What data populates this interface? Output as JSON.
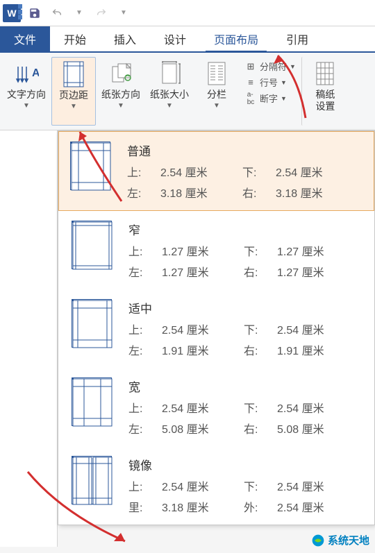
{
  "titlebar": {
    "app_letter": "W"
  },
  "tabs": {
    "file": "文件",
    "home": "开始",
    "insert": "插入",
    "design": "设计",
    "layout": "页面布局",
    "references": "引用"
  },
  "ribbon": {
    "text_direction": "文字方向",
    "margins": "页边距",
    "orientation": "纸张方向",
    "size": "纸张大小",
    "columns": "分栏",
    "breaks": "分隔符",
    "line_numbers": "行号",
    "hyphenation": "断字",
    "manuscript": "稿纸",
    "settings": "设置"
  },
  "dropdown": {
    "items": [
      {
        "name": "普通",
        "top_label": "上:",
        "top_value": "2.54 厘米",
        "bottom_label": "下:",
        "bottom_value": "2.54 厘米",
        "left_label": "左:",
        "left_value": "3.18 厘米",
        "right_label": "右:",
        "right_value": "3.18 厘米"
      },
      {
        "name": "窄",
        "top_label": "上:",
        "top_value": "1.27 厘米",
        "bottom_label": "下:",
        "bottom_value": "1.27 厘米",
        "left_label": "左:",
        "left_value": "1.27 厘米",
        "right_label": "右:",
        "right_value": "1.27 厘米"
      },
      {
        "name": "适中",
        "top_label": "上:",
        "top_value": "2.54 厘米",
        "bottom_label": "下:",
        "bottom_value": "2.54 厘米",
        "left_label": "左:",
        "left_value": "1.91 厘米",
        "right_label": "右:",
        "right_value": "1.91 厘米"
      },
      {
        "name": "宽",
        "top_label": "上:",
        "top_value": "2.54 厘米",
        "bottom_label": "下:",
        "bottom_value": "2.54 厘米",
        "left_label": "左:",
        "left_value": "5.08 厘米",
        "right_label": "右:",
        "right_value": "5.08 厘米"
      },
      {
        "name": "镜像",
        "top_label": "上:",
        "top_value": "2.54 厘米",
        "bottom_label": "下:",
        "bottom_value": "2.54 厘米",
        "left_label": "里:",
        "left_value": "3.18 厘米",
        "right_label": "外:",
        "right_value": "2.54 厘米"
      }
    ]
  },
  "watermark": "系统天地"
}
